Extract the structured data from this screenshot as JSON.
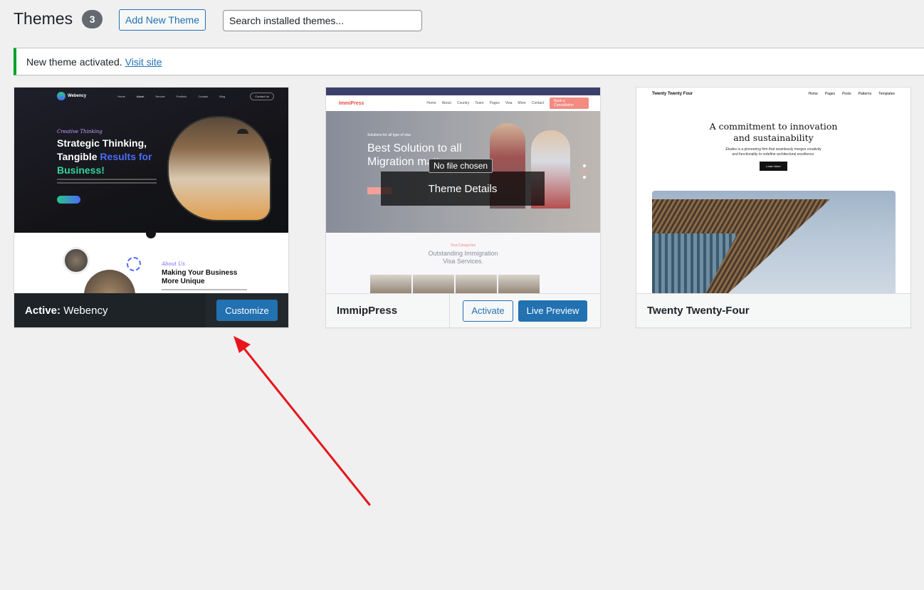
{
  "header": {
    "title": "Themes",
    "count": "3",
    "add_new_label": "Add New Theme",
    "search_placeholder": "Search installed themes..."
  },
  "notice": {
    "text": "New theme activated.",
    "link": "Visit site"
  },
  "themes": [
    {
      "status_prefix": "Active:",
      "name": "Webency",
      "action_label": "Customize",
      "preview": {
        "logo": "Webency",
        "nav": [
          "Home",
          "About",
          "Service",
          "Portfolio",
          "Contact",
          "Blog"
        ],
        "contact_button": "Contact Us",
        "eyebrow": "Creative Thinking",
        "headline_1": "Strategic Thinking,",
        "headline_2a": "Tangible ",
        "headline_2b": "Results for",
        "headline_3": "Business!",
        "about_eyebrow": "About Us",
        "about_title": "Making Your Business More Unique"
      }
    },
    {
      "name": "ImmipPress",
      "activate_label": "Activate",
      "live_preview_label": "Live Preview",
      "overlay_label": "Theme Details",
      "tooltip": "No file chosen",
      "preview": {
        "logo": "ImmiPress",
        "nav": [
          "Home",
          "About",
          "Country",
          "Team",
          "Pages",
          "Visa",
          "More",
          "Contact"
        ],
        "cta": "Book a Consultation",
        "eyebrow": "Solutions for all type of visa",
        "headline": "Best Solution to all Migration matters",
        "section_eyebrow": "Visa Categories",
        "section_title_1": "Outstanding Immigration",
        "section_title_2": "Visa Services."
      }
    },
    {
      "name": "Twenty Twenty-Four",
      "preview": {
        "brand": "Twenty Twenty Four",
        "nav": [
          "Home",
          "Pages",
          "Posts",
          "Patterns",
          "Templates"
        ],
        "heading_1": "A commitment to innovation",
        "heading_2": "and sustainability",
        "para_1": "Études is a pioneering firm that seamlessly merges creativity",
        "para_2": "and functionality to redefine architectural excellence.",
        "button": "Learn More"
      }
    }
  ],
  "colors": {
    "primary": "#2271b1",
    "notice_success": "#00a32a",
    "annotation_arrow": "#e8141b"
  }
}
